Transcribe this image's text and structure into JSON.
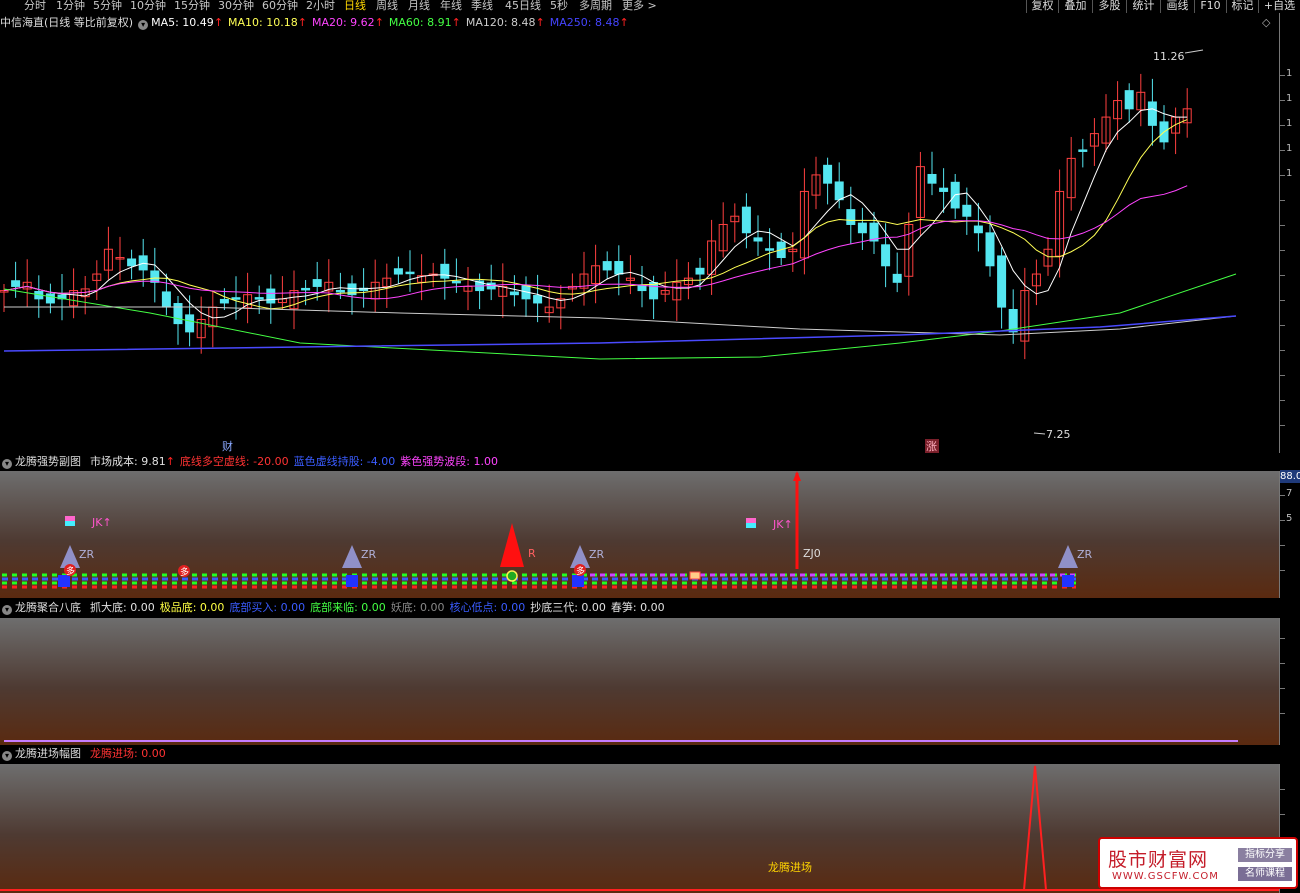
{
  "toolbar": {
    "periods": [
      "分时",
      "1分钟",
      "5分钟",
      "10分钟",
      "15分钟",
      "30分钟",
      "60分钟",
      "2小时",
      "日线",
      "周线",
      "月线",
      "年线",
      "季线",
      "45日线",
      "5秒",
      "多周期",
      "更多 >"
    ],
    "active_period": "日线",
    "right_buttons": [
      "复权",
      "叠加",
      "多股",
      "统计",
      "画线",
      "F10",
      "标记",
      "+自选"
    ]
  },
  "main_panel": {
    "title": "中信海直(日线 等比前复权)",
    "ma": [
      {
        "label": "MA5: 10.49",
        "color": "#ffffff"
      },
      {
        "label": "MA10: 10.18",
        "color": "#ffff55"
      },
      {
        "label": "MA20: 9.62",
        "color": "#ff44ff"
      },
      {
        "label": "MA60: 8.91",
        "color": "#44ff44"
      },
      {
        "label": "MA120: 8.48",
        "color": "#cccccc"
      },
      {
        "label": "MA250: 8.48",
        "color": "#4444ff"
      }
    ],
    "up_arrow": "↑",
    "high_label": "11.26",
    "low_label": "7.25",
    "event_cai": "财",
    "event_zhang": "涨",
    "axis_mark": "◇",
    "axis_digit": "1"
  },
  "sub1": {
    "title": "龙腾强势副图",
    "items": [
      {
        "label": "市场成本: 9.81",
        "color": "#e0e0e0",
        "arrow": "↑"
      },
      {
        "label": "底线多空虚线: -20.00",
        "color": "#ff3333"
      },
      {
        "label": "蓝色虚线持股: -4.00",
        "color": "#3a5cff"
      },
      {
        "label": "紫色强势波段: 1.00",
        "color": "#ff44ff"
      }
    ],
    "axis_top": "88.0",
    "axis_digit": "7",
    "axis_digit2": "5",
    "marks": {
      "zr": "ZR",
      "jk": "JK↑",
      "zj0": "ZJ0",
      "duo": "多",
      "r": "R"
    }
  },
  "sub2": {
    "title": "龙腾聚合八底",
    "items": [
      {
        "label": "抓大底: 0.00",
        "color": "#e0e0e0"
      },
      {
        "label": "极品底: 0.00",
        "color": "#ffff44"
      },
      {
        "label": "底部买入: 0.00",
        "color": "#3a5cff"
      },
      {
        "label": "底部来临: 0.00",
        "color": "#44ff44"
      },
      {
        "label": "妖底: 0.00",
        "color": "#888888"
      },
      {
        "label": "核心低点: 0.00",
        "color": "#3a5cff"
      },
      {
        "label": "抄底三代: 0.00",
        "color": "#e0e0e0"
      },
      {
        "label": "春笋: 0.00",
        "color": "#e0e0e0"
      }
    ]
  },
  "sub3": {
    "title": "龙腾进场幅图",
    "items": [
      {
        "label": "龙腾进场: 0.00",
        "color": "#ff3333"
      }
    ],
    "inline_label": "龙腾进场"
  },
  "watermark": {
    "title": "股市财富网",
    "url": "WWW.GSCFW.COM",
    "tag1": "指标分享",
    "tag2": "名师课程"
  }
}
